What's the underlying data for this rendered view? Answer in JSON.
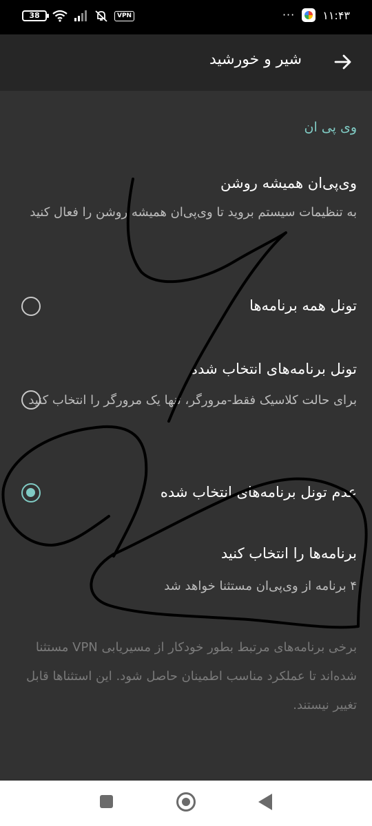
{
  "status_bar": {
    "battery": "38",
    "vpn_badge": "VPN",
    "time": "۱۱:۴۳",
    "more": "···"
  },
  "toolbar": {
    "title": "شیر و خورشید",
    "back_icon": "arrow-right-icon"
  },
  "section": {
    "header": "وی پی ان"
  },
  "preferences": [
    {
      "title": "وی‌پی‌ان همیشه روشن",
      "summary": "به تنظیمات سیستم بروید تا وی‌پی‌ان همیشه روشن را فعال کنید"
    },
    {
      "title": "تونل همه برنامه‌ها",
      "checked": false
    },
    {
      "title": "تونل برنامه‌های انتخاب شده",
      "summary": "برای حالت کلاسیک فقط-مرورگر، تنها یک مرورگر را انتخاب کنید",
      "checked": false
    },
    {
      "title": "عدم تونل برنامه‌های انتخاب شده",
      "checked": true
    },
    {
      "title": "برنامه‌ها را انتخاب کنید",
      "summary": "۴ برنامه از وی‌پی‌ان مستثنا خواهد شد"
    }
  ],
  "footer_note": "برخی برنامه‌های مرتبط بطور خودکار از مسیریابی VPN مستثنا شده‌اند تا عملکرد مناسب اطمینان حاصل شود. این استثناها قابل تغییر نیستند.",
  "nav_bar": {
    "recent_icon": "square-icon",
    "home_icon": "circle-icon",
    "back_icon": "triangle-back-icon"
  },
  "colors": {
    "accent": "#80cbc4",
    "background": "#323232",
    "toolbar": "#262626",
    "status_bar": "#000000"
  }
}
